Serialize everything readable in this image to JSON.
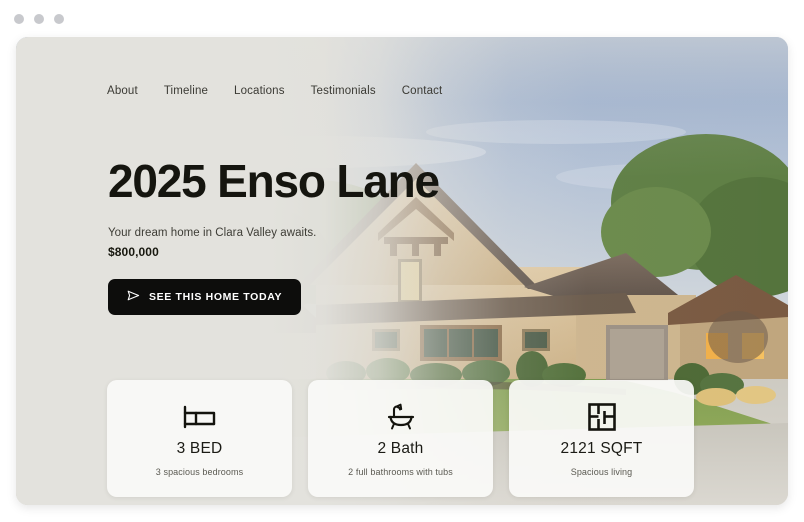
{
  "window": {
    "dots": [
      "window-dot-1",
      "window-dot-2",
      "window-dot-3"
    ]
  },
  "nav": {
    "items": [
      {
        "label": "About"
      },
      {
        "label": "Timeline"
      },
      {
        "label": "Locations"
      },
      {
        "label": "Testimonials"
      },
      {
        "label": "Contact"
      }
    ]
  },
  "hero": {
    "title": "2025 Enso Lane",
    "subtitle": "Your dream home in Clara Valley awaits.",
    "price": "$800,000",
    "cta_label": "SEE THIS HOME TODAY",
    "cta_icon": "play-send-icon",
    "photo_alt": "stone-house-exterior-photo"
  },
  "features": [
    {
      "icon": "bed-icon",
      "value": "3 BED",
      "description": "3 spacious bedrooms"
    },
    {
      "icon": "bathtub-icon",
      "value": "2 Bath",
      "description": "2 full bathrooms with tubs"
    },
    {
      "icon": "floorplan-icon",
      "value": "2121 SQFT",
      "description": "Spacious living"
    }
  ],
  "colors": {
    "panel_bg": "#e3e2dd",
    "card_bg": "#fafaf8",
    "text_dark": "#15150f",
    "text_muted": "#5b5a52",
    "cta_bg": "#0d0d0c",
    "page_bg": "#ffffff",
    "dot": "#c8c9cd"
  }
}
